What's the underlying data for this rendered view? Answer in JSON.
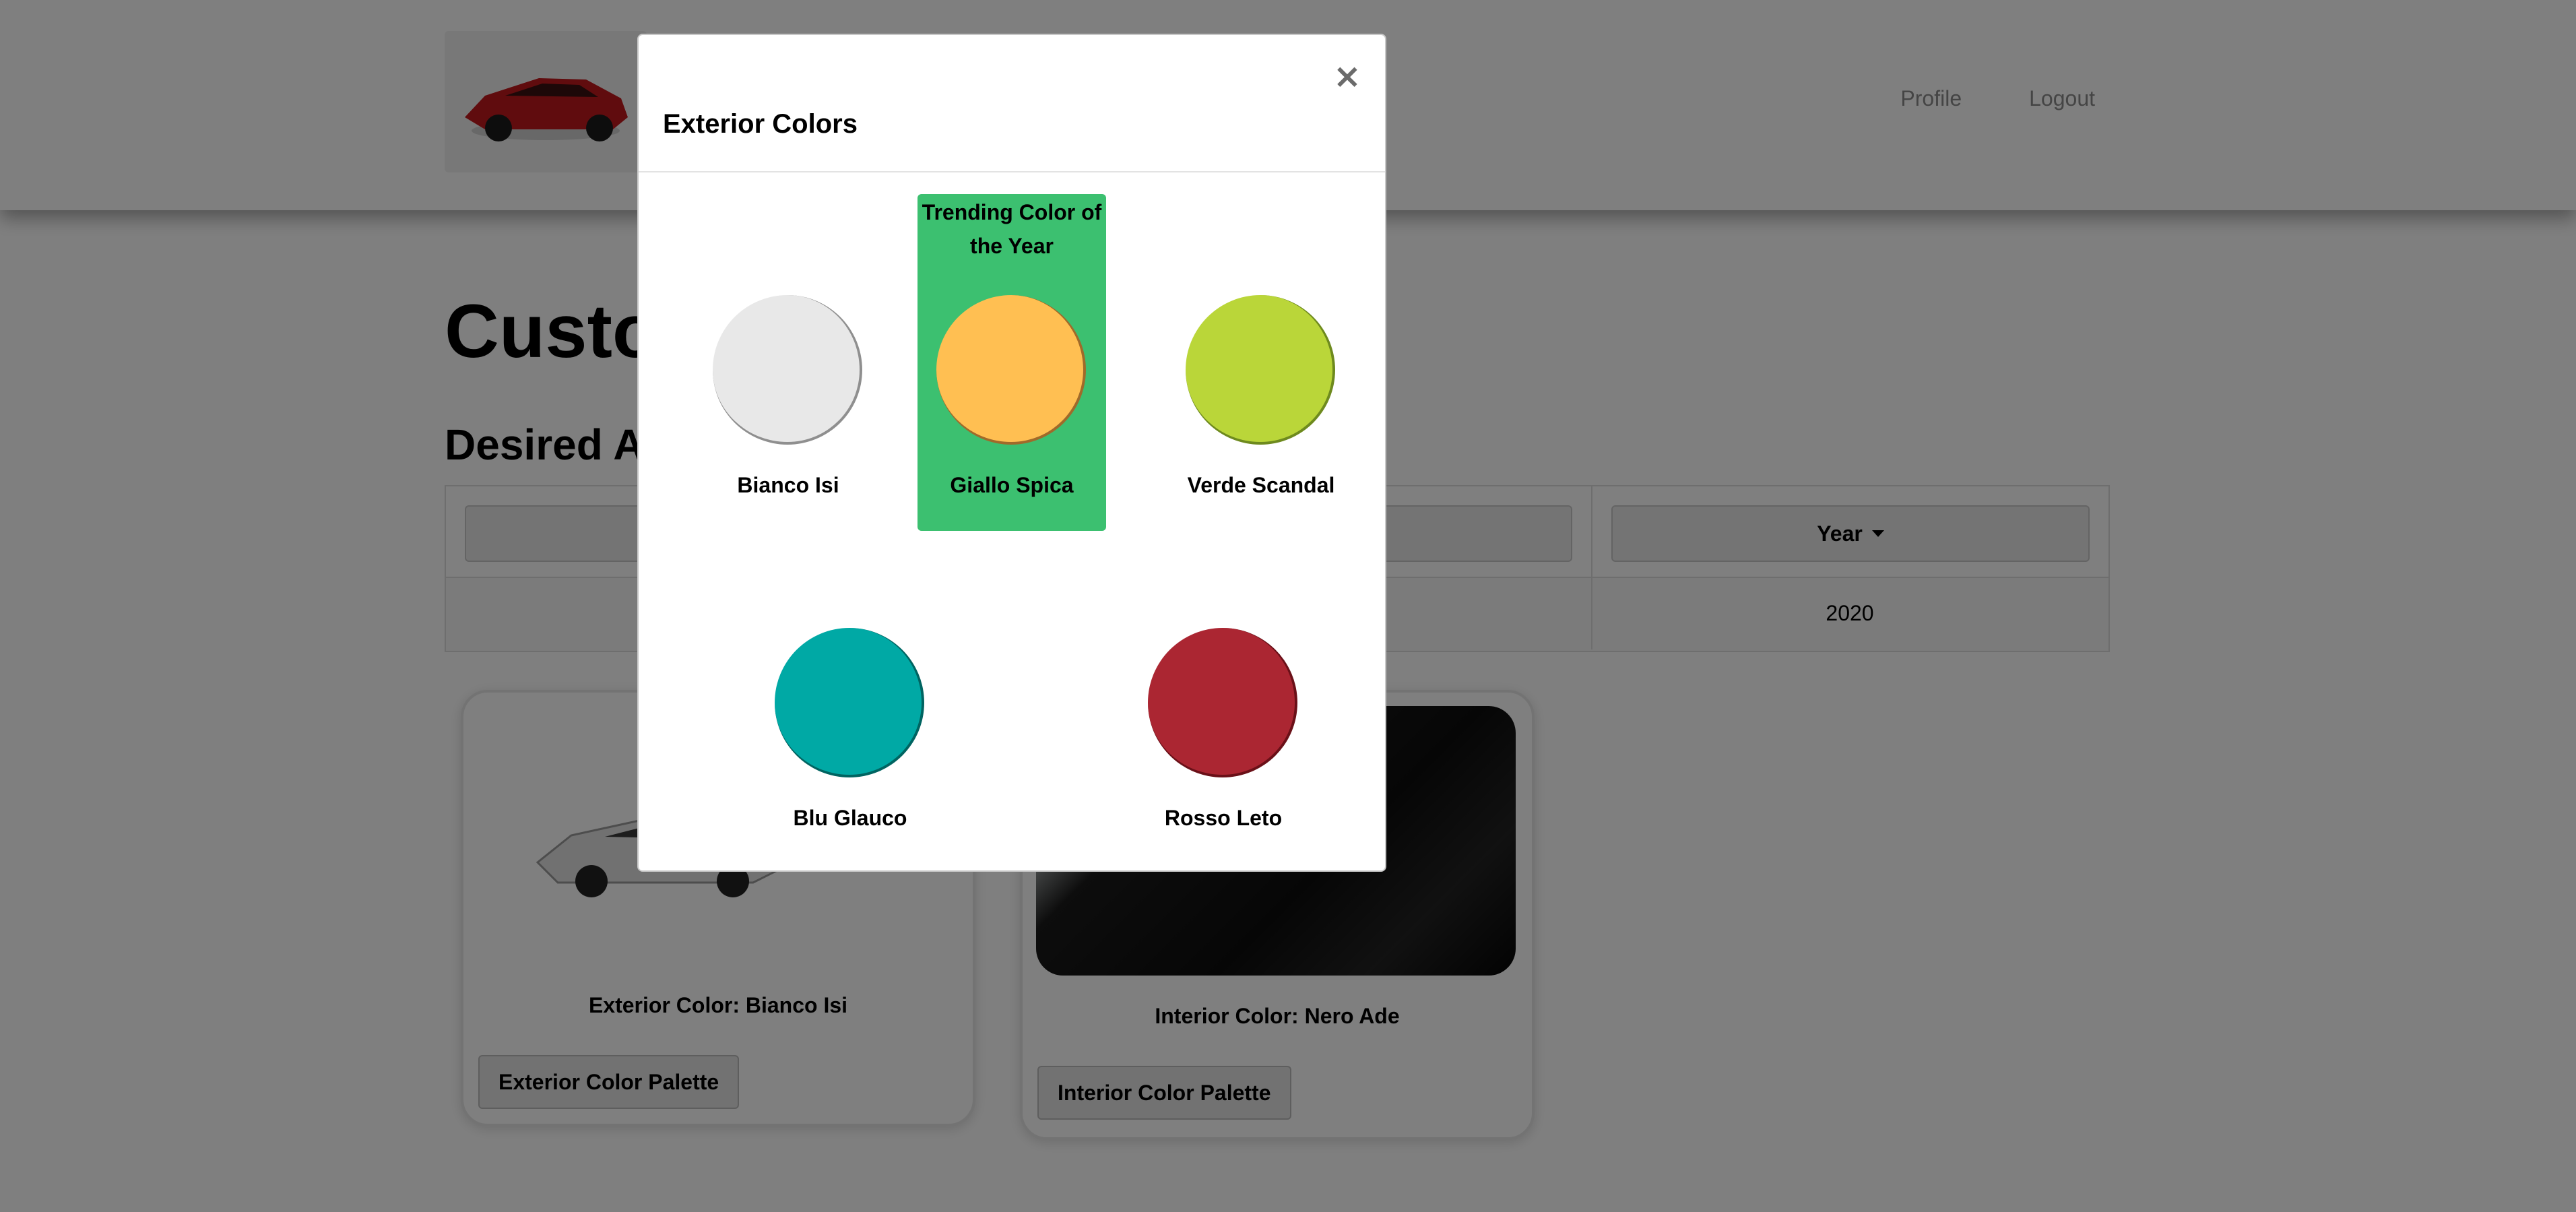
{
  "nav": {
    "links": [
      "Profile",
      "Logout"
    ]
  },
  "page": {
    "title": "Custo",
    "section_title": "Desired A",
    "table": {
      "year_header": "Year",
      "year_value": "2020"
    }
  },
  "cards": {
    "exterior": {
      "label": "Exterior Color: Bianco Isi",
      "button": "Exterior Color Palette"
    },
    "interior": {
      "label": "Interior Color: Nero Ade",
      "button": "Interior Color Palette"
    }
  },
  "modal": {
    "title": "Exterior Colors",
    "close": "×",
    "trending_label": "Trending Color of the Year",
    "colors": [
      {
        "name": "Bianco Isi",
        "hex": "#e8e8e8",
        "trending": false
      },
      {
        "name": "Giallo Spica",
        "hex": "#ffbf52",
        "trending": true
      },
      {
        "name": "Verde Scandal",
        "hex": "#bad639",
        "trending": false
      },
      {
        "name": "Blu Glauco",
        "hex": "#00a9a5",
        "trending": false
      },
      {
        "name": "Rosso Leto",
        "hex": "#ab2632",
        "trending": false
      }
    ],
    "trending_bg": "#3cc070"
  }
}
